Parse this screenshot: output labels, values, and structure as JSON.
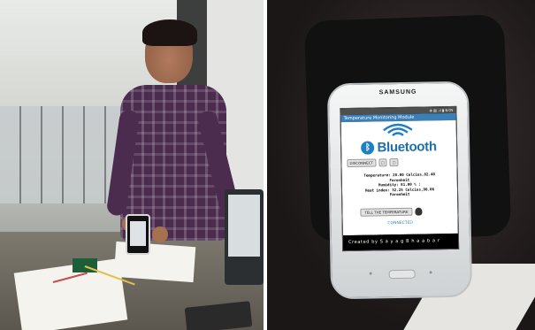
{
  "phone": {
    "brand": "SAMSUNG",
    "status": "⊕ ▤ .ıl ▮ 6:05",
    "app_title": "Temperature Monitoring Module",
    "bluetooth_label": "Bluetooth",
    "disconnect_label": "DISCONNECT",
    "temperature_line": "Temperature: 28.00 Celcius,82.40",
    "temperature_unit": "Farenheit",
    "humidity_line": "Humidity: 81.00 % :",
    "heat_index_line": "Heat index: 32.25 Celcius,90.06",
    "heat_index_unit": "Farenheit",
    "tell_button": "TELL THE TEMPERATURE",
    "connection_status": "CONNECTED",
    "footer": "Created by S a y a g  B h a a b a r",
    "accent_color": "#1f6fb0"
  },
  "icons": {
    "bluetooth": "bluetooth-icon",
    "wifi_waves": "signal-waves-icon",
    "ear": "ear-icon"
  }
}
